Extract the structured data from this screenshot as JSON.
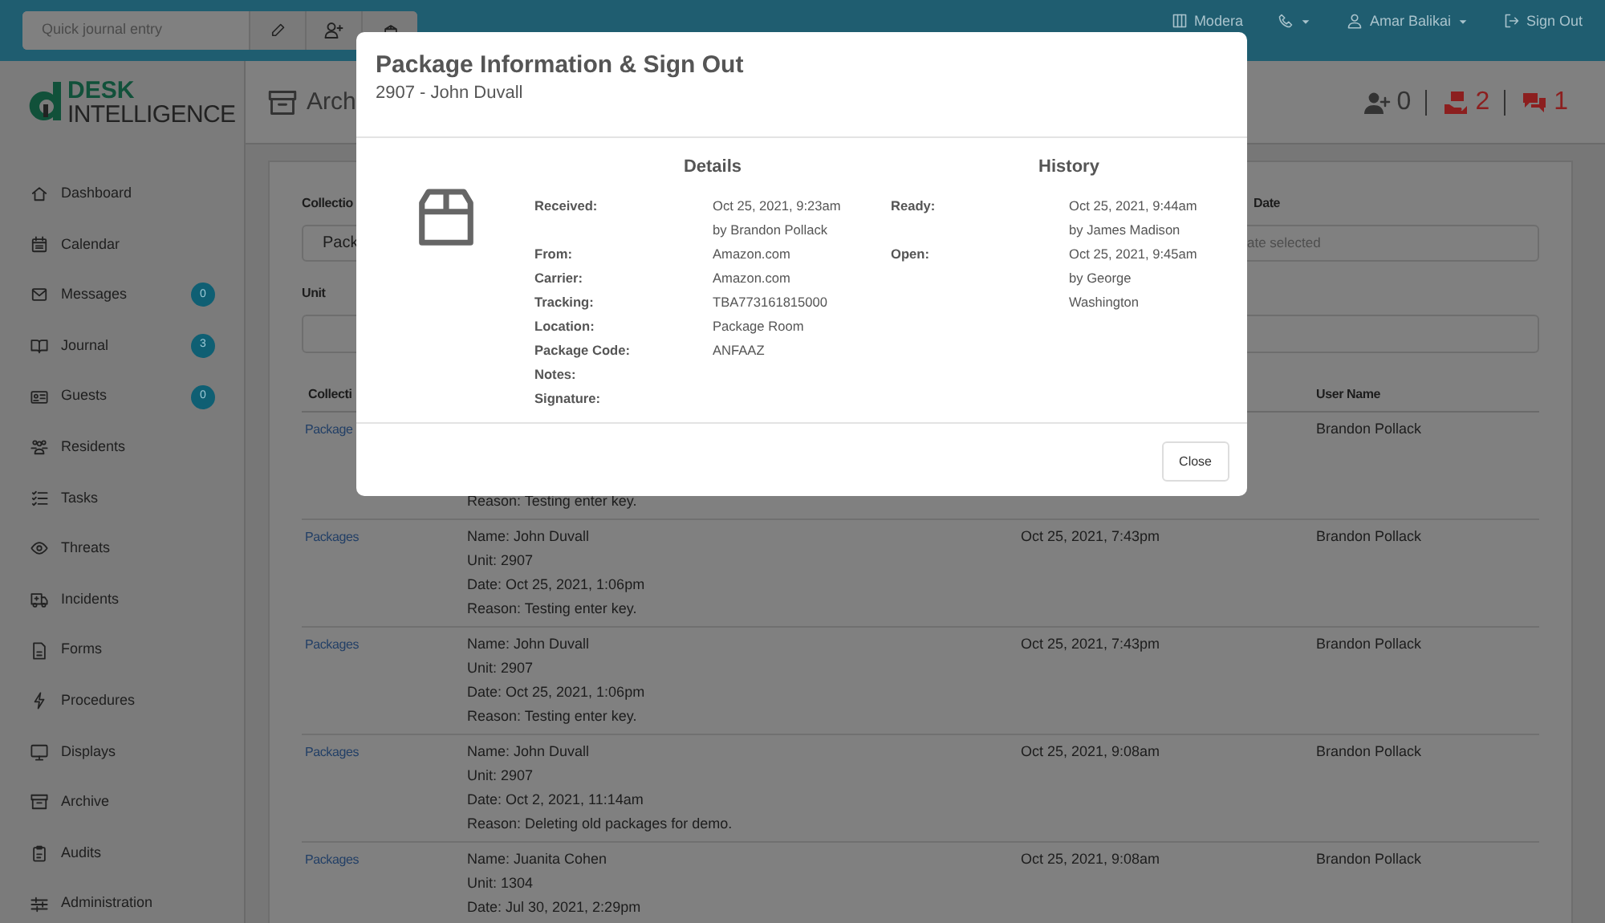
{
  "topbar": {
    "quick_entry": {
      "placeholder": "Quick journal entry"
    },
    "role": "Modera",
    "user": "Amar Balikai",
    "sign_out": "Sign Out"
  },
  "logo": {
    "line_1": "DESK",
    "line_2": "INTELLIGENCE"
  },
  "page_header": {
    "title": "Arch",
    "counters": [
      {
        "kind": "guests",
        "value": "0",
        "color": "#333333"
      },
      {
        "kind": "packages",
        "value": "2",
        "color": "#8c1f1f"
      },
      {
        "kind": "messages",
        "value": "1",
        "color": "#8c1f1f"
      }
    ]
  },
  "sidebar": {
    "items": [
      {
        "label": "Dashboard"
      },
      {
        "label": "Calendar"
      },
      {
        "label": "Messages",
        "badge": "0"
      },
      {
        "label": "Journal",
        "badge": "3"
      },
      {
        "label": "Guests",
        "badge": "0"
      },
      {
        "label": "Residents"
      },
      {
        "label": "Tasks"
      },
      {
        "label": "Threats"
      },
      {
        "label": "Incidents"
      },
      {
        "label": "Forms"
      },
      {
        "label": "Procedures"
      },
      {
        "label": "Displays"
      },
      {
        "label": "Archive"
      },
      {
        "label": "Audits"
      },
      {
        "label": "Administration"
      }
    ]
  },
  "filters": {
    "collection": {
      "label": "Collectio",
      "value": "Pack"
    },
    "unit": {
      "label": "Unit"
    },
    "date": {
      "label": "Date",
      "placeholder": "ate selected"
    }
  },
  "table": {
    "columns": [
      {
        "label": "Collecti"
      },
      {
        "label": "User Name"
      }
    ],
    "rows": [
      {
        "collection": "Package",
        "details": [
          "Reason: Testing enter key."
        ],
        "user": "Brandon Pollack"
      },
      {
        "collection": "Packages",
        "details": [
          "Name: John Duvall",
          "Unit: 2907",
          "Date: Oct 25, 2021, 1:06pm",
          "Reason: Testing enter key."
        ],
        "date": "Oct 25, 2021, 7:43pm",
        "user": "Brandon Pollack"
      },
      {
        "collection": "Packages",
        "details": [
          "Name: John Duvall",
          "Unit: 2907",
          "Date: Oct 25, 2021, 1:06pm",
          "Reason: Testing enter key."
        ],
        "date": "Oct 25, 2021, 7:43pm",
        "user": "Brandon Pollack"
      },
      {
        "collection": "Packages",
        "details": [
          "Name: John Duvall",
          "Unit: 2907",
          "Date: Oct 2, 2021, 11:14am",
          "Reason: Deleting old packages for demo."
        ],
        "date": "Oct 25, 2021, 9:08am",
        "user": "Brandon Pollack"
      },
      {
        "collection": "Packages",
        "details": [
          "Name: Juanita Cohen",
          "Unit: 1304",
          "Date: Jul 30, 2021, 2:29pm"
        ],
        "date": "Oct 25, 2021, 9:08am",
        "user": "Brandon Pollack"
      }
    ]
  },
  "modal": {
    "title": "Package Information & Sign Out",
    "subtitle": "2907 - John Duvall",
    "details": {
      "heading": "Details",
      "fields": [
        {
          "label": "Received:",
          "lines": [
            "Oct 25, 2021, 9:23am",
            "by Brandon Pollack"
          ]
        },
        {
          "label": "From:",
          "lines": [
            "Amazon.com"
          ]
        },
        {
          "label": "Carrier:",
          "lines": [
            "Amazon.com"
          ]
        },
        {
          "label": "Tracking:",
          "lines": [
            "TBA773161815000"
          ]
        },
        {
          "label": "Location:",
          "lines": [
            "Package Room"
          ]
        },
        {
          "label": "Package Code:",
          "lines": [
            "ANFAAZ"
          ]
        },
        {
          "label": "Notes:"
        },
        {
          "label": "Signature:"
        }
      ]
    },
    "history": {
      "heading": "History",
      "fields": [
        {
          "label": "Ready:",
          "lines": [
            "Oct 25, 2021, 9:44am",
            "by James Madison"
          ]
        },
        {
          "label": "Open:",
          "lines": [
            "Oct 25, 2021, 9:45am",
            "by George",
            "Washington"
          ]
        }
      ]
    },
    "close_button": "Close"
  }
}
